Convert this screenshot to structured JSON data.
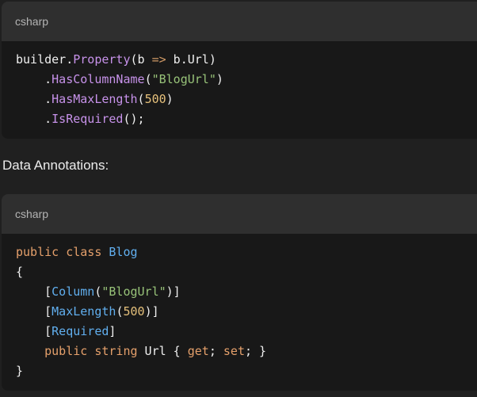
{
  "blocks": [
    {
      "language": "csharp",
      "lines": [
        [
          {
            "t": "builder",
            "c": "plain"
          },
          {
            "t": ".",
            "c": "plain"
          },
          {
            "t": "Property",
            "c": "fn"
          },
          {
            "t": "(b ",
            "c": "plain"
          },
          {
            "t": "=>",
            "c": "op"
          },
          {
            "t": " b.Url)",
            "c": "plain"
          }
        ],
        [
          {
            "t": "    .",
            "c": "plain"
          },
          {
            "t": "HasColumnName",
            "c": "fn"
          },
          {
            "t": "(",
            "c": "plain"
          },
          {
            "t": "\"BlogUrl\"",
            "c": "str"
          },
          {
            "t": ")",
            "c": "plain"
          }
        ],
        [
          {
            "t": "    .",
            "c": "plain"
          },
          {
            "t": "HasMaxLength",
            "c": "fn"
          },
          {
            "t": "(",
            "c": "plain"
          },
          {
            "t": "500",
            "c": "num"
          },
          {
            "t": ")",
            "c": "plain"
          }
        ],
        [
          {
            "t": "    .",
            "c": "plain"
          },
          {
            "t": "IsRequired",
            "c": "fn"
          },
          {
            "t": "();",
            "c": "plain"
          }
        ]
      ]
    },
    {
      "language": "csharp",
      "lines": [
        [
          {
            "t": "public",
            "c": "kw"
          },
          {
            "t": " ",
            "c": "plain"
          },
          {
            "t": "class",
            "c": "kw"
          },
          {
            "t": " ",
            "c": "plain"
          },
          {
            "t": "Blog",
            "c": "type"
          }
        ],
        [
          {
            "t": "{",
            "c": "plain"
          }
        ],
        [
          {
            "t": "    [",
            "c": "plain"
          },
          {
            "t": "Column",
            "c": "attr"
          },
          {
            "t": "(",
            "c": "plain"
          },
          {
            "t": "\"BlogUrl\"",
            "c": "str"
          },
          {
            "t": ")]",
            "c": "plain"
          }
        ],
        [
          {
            "t": "    [",
            "c": "plain"
          },
          {
            "t": "MaxLength",
            "c": "attr"
          },
          {
            "t": "(",
            "c": "plain"
          },
          {
            "t": "500",
            "c": "num"
          },
          {
            "t": ")]",
            "c": "plain"
          }
        ],
        [
          {
            "t": "    [",
            "c": "plain"
          },
          {
            "t": "Required",
            "c": "attr"
          },
          {
            "t": "]",
            "c": "plain"
          }
        ],
        [
          {
            "t": "    ",
            "c": "plain"
          },
          {
            "t": "public",
            "c": "kw"
          },
          {
            "t": " ",
            "c": "plain"
          },
          {
            "t": "string",
            "c": "kw"
          },
          {
            "t": " Url { ",
            "c": "plain"
          },
          {
            "t": "get",
            "c": "kw"
          },
          {
            "t": "; ",
            "c": "plain"
          },
          {
            "t": "set",
            "c": "kw"
          },
          {
            "t": "; }",
            "c": "plain"
          }
        ],
        [
          {
            "t": "}",
            "c": "plain"
          }
        ]
      ]
    }
  ],
  "prose": {
    "data_annotations_heading": "Data Annotations:"
  },
  "colors": {
    "page_background": "#202020",
    "code_background": "#181818",
    "header_background": "#2f2f2f",
    "method": "#c792ea",
    "string": "#98c379",
    "number": "#e5c07b",
    "keyword": "#e5a06b",
    "type": "#61afef"
  }
}
